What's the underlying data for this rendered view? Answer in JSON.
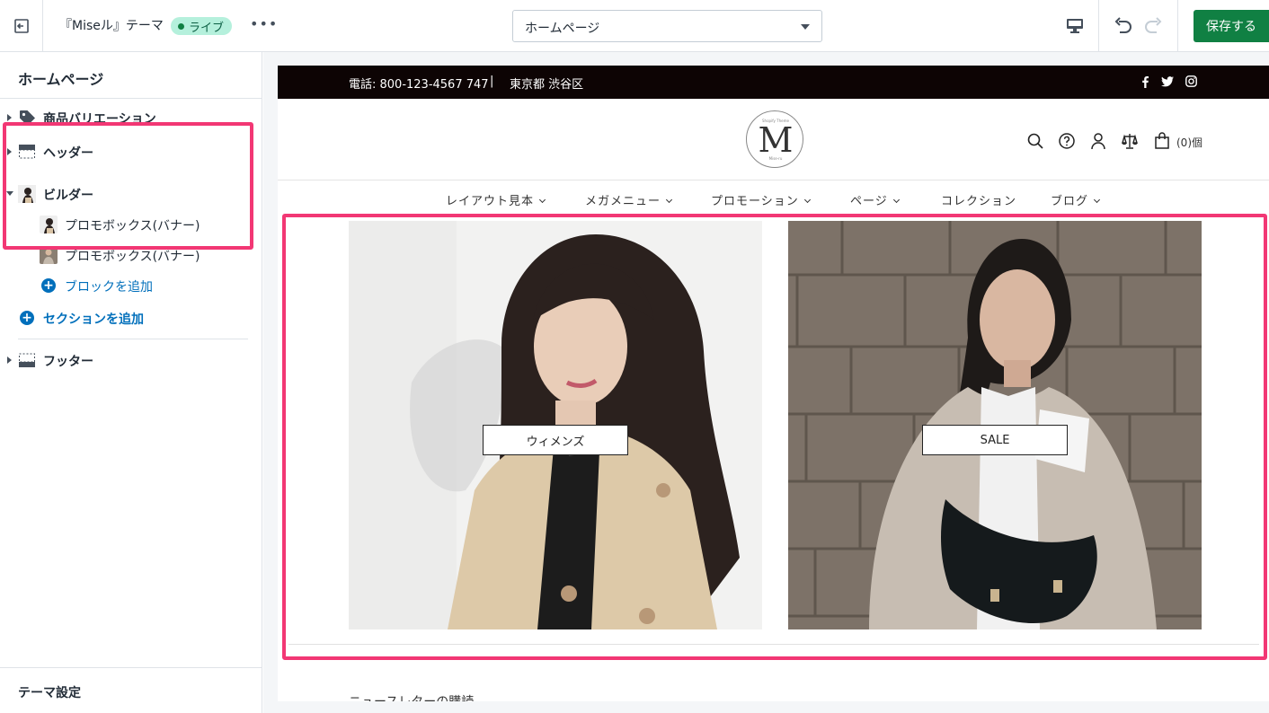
{
  "topbar": {
    "theme_name": "『Miseル』テーマ",
    "live_badge": "ライブ",
    "more": "•••",
    "page_select": "ホームページ",
    "save_label": "保存する"
  },
  "sidebar": {
    "title": "ホームページ",
    "sections": [
      {
        "label": "商品バリエーション",
        "icon": "tag-icon"
      },
      {
        "label": "ヘッダー",
        "icon": "header-layout-icon"
      },
      {
        "label": "ビルダー",
        "icon": "builder-thumbnail-icon"
      }
    ],
    "builder_blocks": [
      {
        "label": "プロモボックス(バナー)"
      },
      {
        "label": "プロモボックス(バナー)"
      }
    ],
    "add_block": "ブロックを追加",
    "add_section": "セクションを追加",
    "footer": "フッター",
    "theme_settings": "テーマ設定"
  },
  "store": {
    "announcement": {
      "phone": "電話: 800-123-4567 747",
      "separator": "|",
      "address": "東京都 渋谷区",
      "social": [
        "f",
        "t",
        "ig"
      ]
    },
    "logo": {
      "small_top": "Shopify Theme",
      "letter": "M",
      "small_bottom": "Mise-ru"
    },
    "cart_count": "(0)個",
    "nav": [
      {
        "label": "レイアウト見本",
        "dropdown": true
      },
      {
        "label": "メガメニュー",
        "dropdown": true
      },
      {
        "label": "プロモーション",
        "dropdown": true
      },
      {
        "label": "ページ",
        "dropdown": true
      },
      {
        "label": "コレクション",
        "dropdown": false
      },
      {
        "label": "ブログ",
        "dropdown": true
      }
    ],
    "promos": [
      {
        "button": "ウィメンズ"
      },
      {
        "button": "SALE"
      }
    ],
    "newsletter_heading": "ニュースレターの購読"
  },
  "colors": {
    "accent_highlight": "#f23774",
    "save_green": "#108043",
    "link_blue": "#006fbb",
    "announcement_bg": "#0d0404"
  }
}
